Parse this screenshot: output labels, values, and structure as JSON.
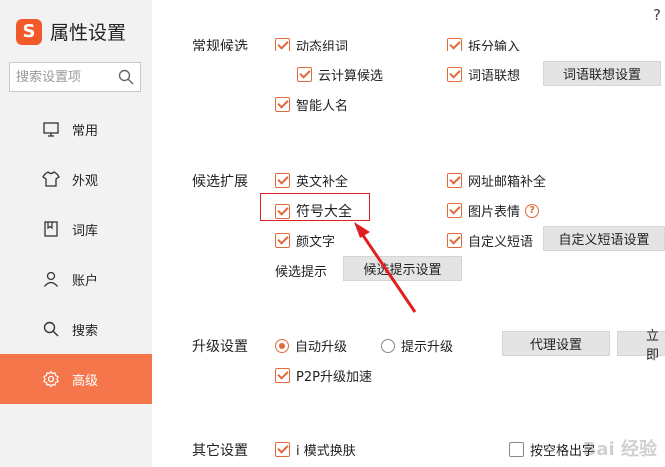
{
  "app": {
    "logo_letter": "S",
    "title": "属性设置",
    "help": "?"
  },
  "search": {
    "placeholder": "搜索设置项"
  },
  "nav": {
    "items": [
      {
        "label": "常用",
        "icon": "monitor-icon"
      },
      {
        "label": "外观",
        "icon": "shirt-icon"
      },
      {
        "label": "词库",
        "icon": "book-icon"
      },
      {
        "label": "账户",
        "icon": "user-icon"
      },
      {
        "label": "搜索",
        "icon": "search-icon"
      },
      {
        "label": "高级",
        "icon": "gear-icon",
        "active": true
      }
    ]
  },
  "sections": {
    "conventional": {
      "title": "常规候选",
      "partial_left": "动态组词",
      "partial_right": "拆分输入",
      "cloud": "云计算候选",
      "phrase_assoc": "词语联想",
      "phrase_assoc_btn": "词语联想设置",
      "smart_name": "智能人名"
    },
    "candidate_ext": {
      "title": "候选扩展",
      "english": "英文补全",
      "web_email": "网址邮箱补全",
      "symbols": "符号大全",
      "emoji_pic": "图片表情",
      "info_mark": "?",
      "kaomoji": "颜文字",
      "custom_phrase": "自定义短语",
      "custom_phrase_btn": "自定义短语设置",
      "hint_label": "候选提示",
      "hint_btn": "候选提示设置"
    },
    "upgrade": {
      "title": "升级设置",
      "auto": "自动升级",
      "prompt": "提示升级",
      "proxy_btn": "代理设置",
      "now_btn": "立即",
      "p2p": "P2P升级加速"
    },
    "other": {
      "title": "其它设置",
      "i_mode": "i 模式换肤",
      "space_output": "按空格出字"
    }
  },
  "watermark": "Bai 经验",
  "colors": {
    "accent": "#f4764a",
    "check": "#e0693a",
    "highlight": "#e02020"
  }
}
